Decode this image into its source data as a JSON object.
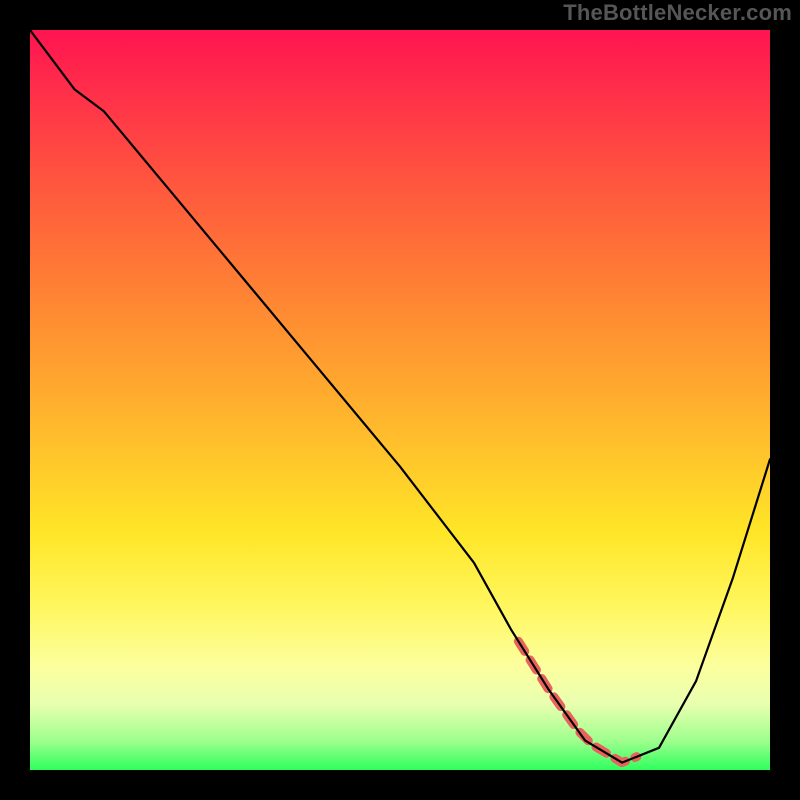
{
  "attribution": "TheBottleNecker.com",
  "colors": {
    "frame": "#000000",
    "curve": "#000000",
    "highlight": "#e9635d",
    "gradient_top": "#ff1450",
    "gradient_bottom": "#2fff5e"
  },
  "chart_data": {
    "type": "line",
    "title": "",
    "xlabel": "",
    "ylabel": "",
    "xlim": [
      0,
      100
    ],
    "ylim": [
      0,
      100
    ],
    "x": [
      0,
      6,
      10,
      20,
      30,
      40,
      50,
      60,
      65,
      70,
      75,
      80,
      85,
      90,
      95,
      100
    ],
    "values": [
      100,
      92,
      89,
      77,
      65,
      53,
      41,
      28,
      19,
      11,
      4,
      1,
      3,
      12,
      26,
      42
    ],
    "highlight_range_x": [
      66,
      82
    ],
    "gradient": {
      "description": "vertical risk/usage gradient",
      "stops": [
        {
          "pos": 0.0,
          "color": "#ff1450"
        },
        {
          "pos": 0.55,
          "color": "#ffbd2c"
        },
        {
          "pos": 0.86,
          "color": "#fcff9e"
        },
        {
          "pos": 1.0,
          "color": "#2fff5e"
        }
      ]
    }
  }
}
